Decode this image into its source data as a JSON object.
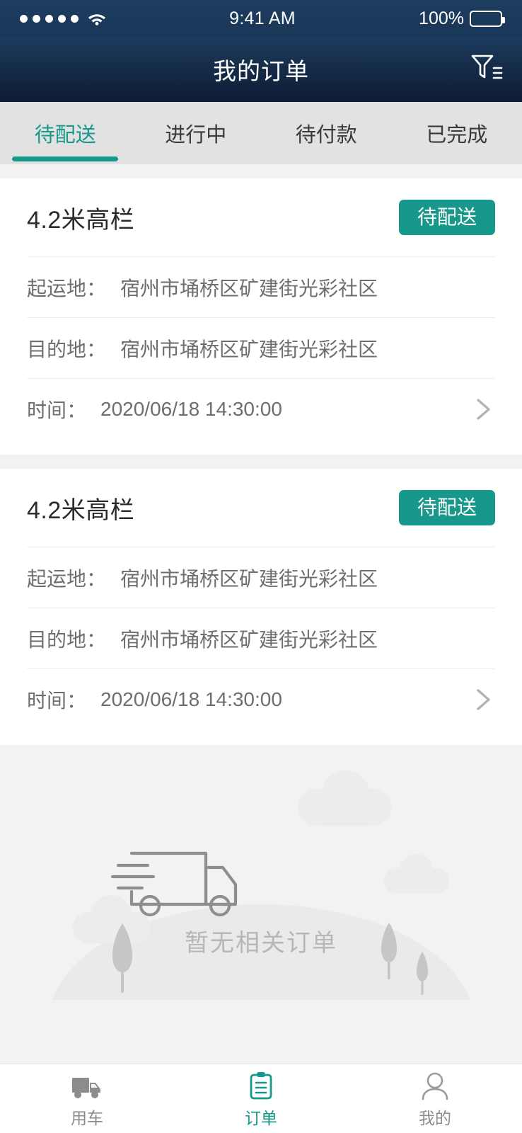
{
  "status_bar": {
    "signal_dots": 5,
    "wifi_icon": "wifi-icon",
    "time": "9:41 AM",
    "battery_percent": "100%",
    "battery_icon": "battery-full-icon"
  },
  "header": {
    "title": "我的订单",
    "filter_icon": "filter-funnel-icon"
  },
  "tabs": {
    "active_index": 0,
    "items": [
      {
        "label": "待配送"
      },
      {
        "label": "进行中"
      },
      {
        "label": "待付款"
      },
      {
        "label": "已完成"
      }
    ]
  },
  "orders": [
    {
      "title": "4.2米高栏",
      "status_badge": "待配送",
      "origin_label": "起运地：",
      "origin_value": "宿州市埇桥区矿建街光彩社区",
      "destination_label": "目的地：",
      "destination_value": "宿州市埇桥区矿建街光彩社区",
      "time_label": "时间：",
      "time_value": "2020/06/18 14:30:00",
      "chevron_icon": "chevron-right-icon"
    },
    {
      "title": "4.2米高栏",
      "status_badge": "待配送",
      "origin_label": "起运地：",
      "origin_value": "宿州市埇桥区矿建街光彩社区",
      "destination_label": "目的地：",
      "destination_value": "宿州市埇桥区矿建街光彩社区",
      "time_label": "时间：",
      "time_value": "2020/06/18 14:30:00",
      "chevron_icon": "chevron-right-icon"
    }
  ],
  "empty_state": {
    "text": "暂无相关订单",
    "illustration_icon": "delivery-truck-illustration"
  },
  "bottom_nav": {
    "active_index": 1,
    "items": [
      {
        "label": "用车",
        "icon": "truck-icon"
      },
      {
        "label": "订单",
        "icon": "clipboard-icon"
      },
      {
        "label": "我的",
        "icon": "person-icon"
      }
    ]
  },
  "colors": {
    "accent_teal": "#17988a",
    "header_navy_top": "#1c3b5d",
    "header_navy_bottom": "#0d1c33",
    "tabbar_gray": "#e2e2e2",
    "page_bg": "#f2f2f2",
    "empty_text": "#b7b7b7"
  }
}
